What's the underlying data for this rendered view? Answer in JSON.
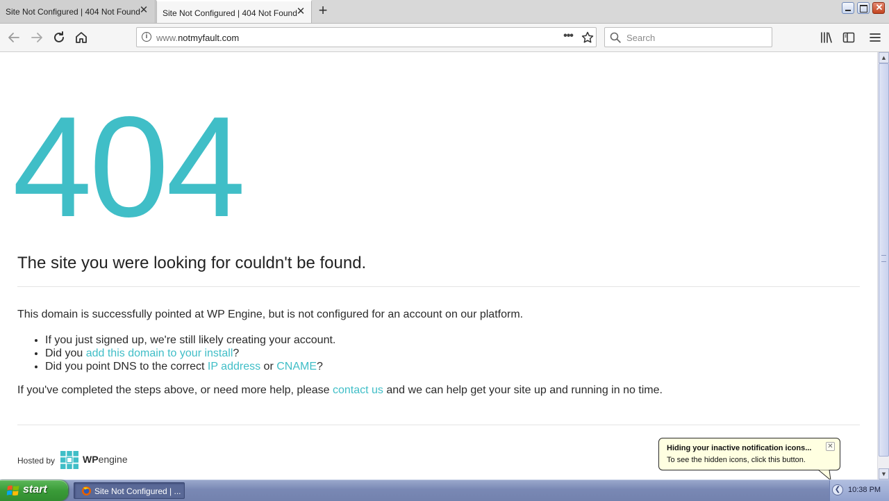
{
  "browser": {
    "tabs": [
      {
        "title": "Site Not Configured | 404 Not Found",
        "active": false
      },
      {
        "title": "Site Not Configured | 404 Not Found",
        "active": true
      }
    ],
    "url_host_prefix": "www.",
    "url_domain": "notmyfault.com",
    "search_placeholder": "Search",
    "icons": {
      "back": "arrow-left-icon",
      "forward": "arrow-right-icon",
      "reload": "reload-icon",
      "home": "home-icon",
      "page_actions": "ellipsis-icon",
      "bookmark": "star-icon",
      "library": "library-icon",
      "sidebar": "sidebar-icon",
      "menu": "hamburger-icon"
    }
  },
  "page": {
    "code": "404",
    "headline": "The site you were looking for couldn't be found.",
    "intro": "This domain is successfully pointed at WP Engine, but is not configured for an account on our platform.",
    "bullets": {
      "b1": "If you just signed up, we're still likely creating your account.",
      "b2_pre": "Did you ",
      "b2_link": "add this domain to your install",
      "b2_post": "?",
      "b3_pre": "Did you point DNS to the correct ",
      "b3_link1": "IP address",
      "b3_mid": " or ",
      "b3_link2": "CNAME",
      "b3_post": "?"
    },
    "outro_pre": "If you've completed the steps above, or need more help, please ",
    "outro_link": "contact us",
    "outro_post": " and we can help get your site up and running in no time.",
    "hosted_by": "Hosted by",
    "logo_wp": "WP",
    "logo_engine": "engine",
    "accent_color": "#40bec7"
  },
  "notification": {
    "title": "Hiding your inactive notification icons...",
    "text": "To see the hidden icons, click this button."
  },
  "taskbar": {
    "start_label": "start",
    "task_label": "Site Not Configured | ...",
    "clock": "10:38 PM"
  }
}
